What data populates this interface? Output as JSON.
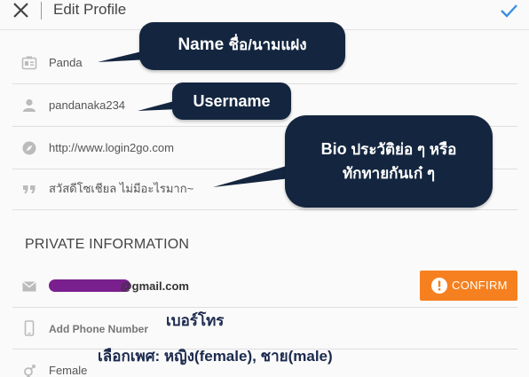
{
  "header": {
    "close_icon": "close-icon",
    "title": "Edit Profile",
    "done_icon": "checkmark-icon",
    "accent_color": "#3d8ee0"
  },
  "profile": {
    "name": "Panda",
    "username": "pandanaka234",
    "website": "http://www.login2go.com",
    "bio": "สวัสดีโซเชียล ไม่มีอะไรมาก~"
  },
  "private": {
    "section_title": "PRIVATE INFORMATION",
    "email_visible": "@gmail.com",
    "confirm_label": "CONFIRM",
    "confirm_color": "#f6801f",
    "phone_placeholder": "Add Phone Number",
    "gender": "Female"
  },
  "callouts": {
    "name_bold": "Name",
    "name_thai": "ชื่อ/นามแฝง",
    "username": "Username",
    "bio_line1_bold": "Bio",
    "bio_line1_thai": "ประวัติย่อ ๆ หรือ",
    "bio_line2": "ทักทายกันเก๋ ๆ",
    "bubble_color": "#14263f"
  },
  "annotations": {
    "phone": "เบอร์โทร",
    "gender": "เลือกเพศ: หญิง(female), ชาย(male)"
  }
}
